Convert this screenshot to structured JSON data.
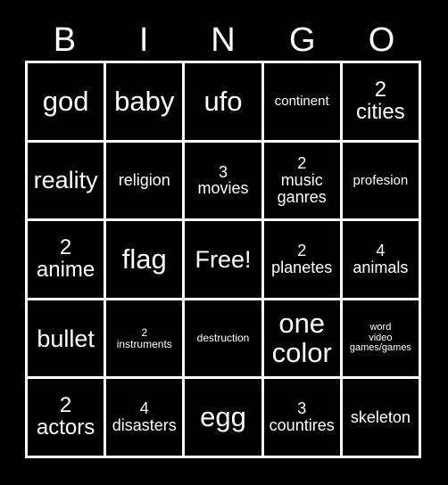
{
  "card": {
    "title": "BINGO",
    "background_color": "#000000",
    "text_color": "#ffffff",
    "border_color": "#ffffff",
    "header_letters": [
      "B",
      "I",
      "N",
      "G",
      "O"
    ],
    "columns": 5,
    "rows": 5,
    "cells": [
      {
        "text": "god",
        "size": "fs-xxl"
      },
      {
        "text": "baby",
        "size": "fs-xxl"
      },
      {
        "text": "ufo",
        "size": "fs-xxl"
      },
      {
        "text": "continent",
        "size": "fs-sm"
      },
      {
        "text": "2\ncities",
        "size": "fs-lg"
      },
      {
        "text": "reality",
        "size": "fs-xl"
      },
      {
        "text": "religion",
        "size": "fs-md"
      },
      {
        "text": "3\nmovies",
        "size": "fs-md"
      },
      {
        "text": "2\nmusic\nganres",
        "size": "fs-md"
      },
      {
        "text": "profesion",
        "size": "fs-sm"
      },
      {
        "text": "2\nanime",
        "size": "fs-lg"
      },
      {
        "text": "flag",
        "size": "fs-xxl"
      },
      {
        "text": "Free!",
        "size": "fs-xl"
      },
      {
        "text": "2\nplanetes",
        "size": "fs-md"
      },
      {
        "text": "4\nanimals",
        "size": "fs-md"
      },
      {
        "text": "bullet",
        "size": "fs-xl"
      },
      {
        "text": "2\ninstruments",
        "size": "fs-xs"
      },
      {
        "text": "destruction",
        "size": "fs-xs"
      },
      {
        "text": "one\ncolor",
        "size": "fs-xxl"
      },
      {
        "text": "word\nvideo\ngames/games",
        "size": "fs-xxs"
      },
      {
        "text": "2\nactors",
        "size": "fs-lg"
      },
      {
        "text": "4\ndisasters",
        "size": "fs-md"
      },
      {
        "text": "egg",
        "size": "fs-xxl"
      },
      {
        "text": "3\ncountires",
        "size": "fs-md"
      },
      {
        "text": "skeleton",
        "size": "fs-md"
      }
    ]
  }
}
